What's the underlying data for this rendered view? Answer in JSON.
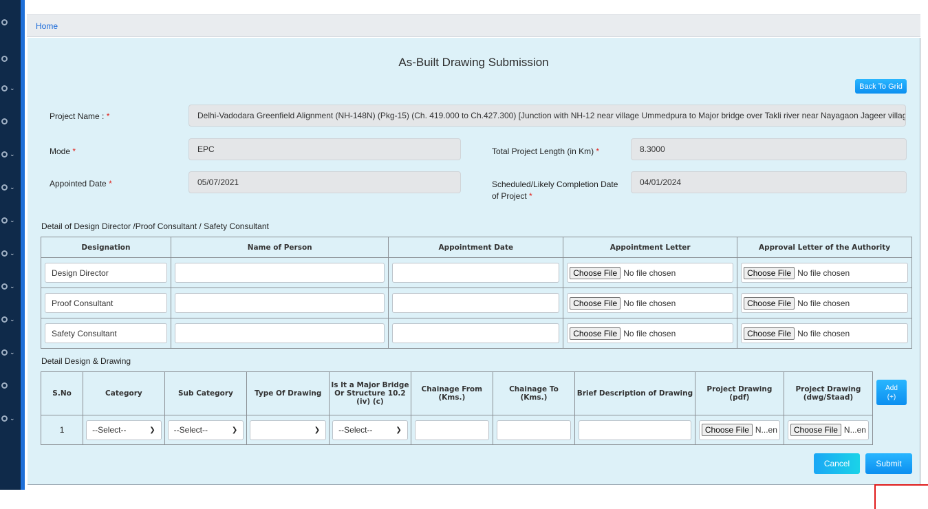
{
  "breadcrumb": {
    "home": "Home"
  },
  "page": {
    "title": "As-Built Drawing Submission",
    "back_button": "Back To Grid"
  },
  "project": {
    "name_label": "Project Name : ",
    "name_value": "Delhi-Vadodara Greenfield Alignment (NH-148N) (Pkg-15) (Ch. 419.000 to Ch.427.300) [Junction with NH-12 near village Ummedpura to Major bridge over Takli river near Nayagaon Jageer village]",
    "mode_label": "Mode ",
    "mode_value": "EPC",
    "length_label": "Total Project Length (in Km) ",
    "length_value": "8.3000",
    "appointed_label": "Appointed Date ",
    "appointed_value": "05/07/2021",
    "completion_label_1": "Scheduled/Likely Completion Date",
    "completion_label_2": "of Project ",
    "completion_value": "04/01/2024",
    "required_mark": "*"
  },
  "consultants": {
    "section_title": "Detail of Design Director /Proof Consultant / Safety Consultant",
    "headers": [
      "Designation",
      "Name of Person",
      "Appointment Date",
      "Appointment Letter",
      "Approval Letter of the Authority"
    ],
    "rows": [
      {
        "designation": "Design Director"
      },
      {
        "designation": "Proof Consultant"
      },
      {
        "designation": "Safety Consultant"
      }
    ],
    "file_button": "Choose File",
    "file_status": "No file chosen"
  },
  "drawings": {
    "section_title": "Detail Design & Drawing",
    "headers": [
      "S.No",
      "Category",
      "Sub Category",
      "Type Of Drawing",
      "Is It a Major Bridge Or Structure 10.2 (iv) (c)",
      "Chainage From (Kms.)",
      "Chainage To (Kms.)",
      "Brief Description of Drawing",
      "Project Drawing (pdf)",
      "Project Drawing (dwg/Staad)"
    ],
    "add_button_1": "Add",
    "add_button_2": "(+)",
    "row": {
      "sno": "1",
      "category": "--Select--",
      "sub_category": "--Select--",
      "type_of_drawing": "",
      "major_bridge": "--Select--",
      "file_button": "Choose File",
      "file_status": "N...en"
    }
  },
  "actions": {
    "cancel": "Cancel",
    "submit": "Submit"
  },
  "colors": {
    "accent": "#0c8ff0",
    "panel": "#ddf1f8",
    "sidebar": "#0f2a4a",
    "required": "#e0201a"
  }
}
